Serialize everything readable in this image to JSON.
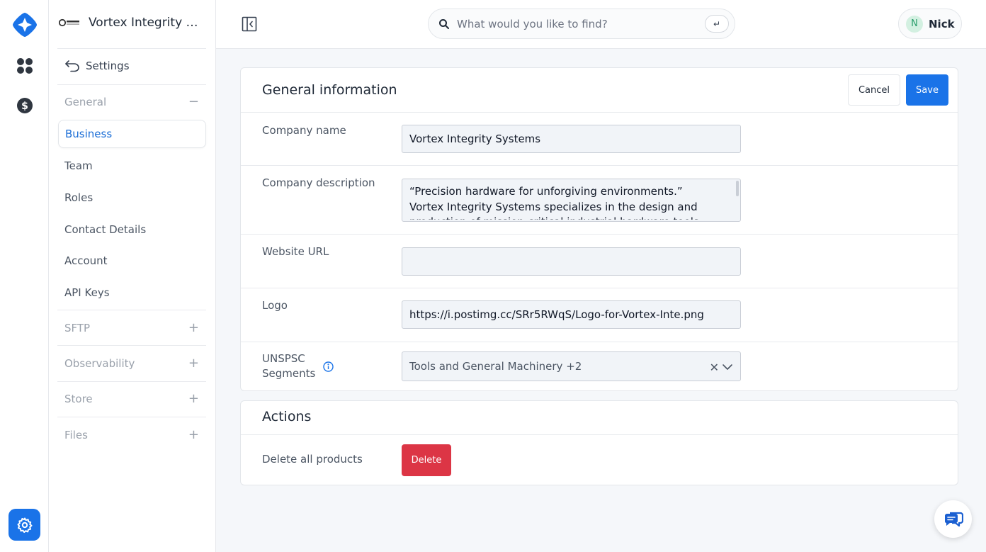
{
  "rail": {
    "logo_icon": "diamond-logo-icon",
    "items": [
      {
        "icon": "apps-grid-icon"
      },
      {
        "icon": "dollar-circle-icon"
      }
    ],
    "settings_icon": "gear-icon",
    "accent": "#1a73e8"
  },
  "sidebar": {
    "org_name": "Vortex Integrity Systems",
    "back_label": "Settings",
    "groups": [
      {
        "label": "General",
        "toggle": "−",
        "items": [
          "Business",
          "Team",
          "Roles",
          "Contact Details",
          "Account",
          "API Keys"
        ],
        "active": "Business"
      },
      {
        "label": "SFTP",
        "toggle": "+"
      },
      {
        "label": "Observability",
        "toggle": "+"
      },
      {
        "label": "Store",
        "toggle": "+"
      },
      {
        "label": "Files",
        "toggle": "+"
      }
    ]
  },
  "topbar": {
    "search_placeholder": "What would you like to find?",
    "enter_key": "↵",
    "user": {
      "initial": "N",
      "name": "Nick"
    }
  },
  "general_info": {
    "title": "General information",
    "cancel_label": "Cancel",
    "save_label": "Save",
    "fields": {
      "company_name": {
        "label": "Company name",
        "value": "Vortex Integrity Systems"
      },
      "company_description": {
        "label": "Company description",
        "lines": [
          "“Precision hardware for unforgiving environments.”",
          "Vortex Integrity Systems specializes in the design and",
          "production of mission-critical industrial hardware tools"
        ]
      },
      "website_url": {
        "label": "Website URL",
        "value": ""
      },
      "logo": {
        "label": "Logo",
        "value": "https://i.postimg.cc/SRr5RWqS/Logo-for-Vortex-Inte.png"
      },
      "unspsc": {
        "label_line1": "UNSPSC",
        "label_line2": "Segments",
        "value": "Tools and General Machinery +2",
        "clear": "✕"
      }
    }
  },
  "actions": {
    "title": "Actions",
    "delete_products_label": "Delete all products",
    "delete_label": "Delete",
    "danger_color": "#dc3545"
  }
}
